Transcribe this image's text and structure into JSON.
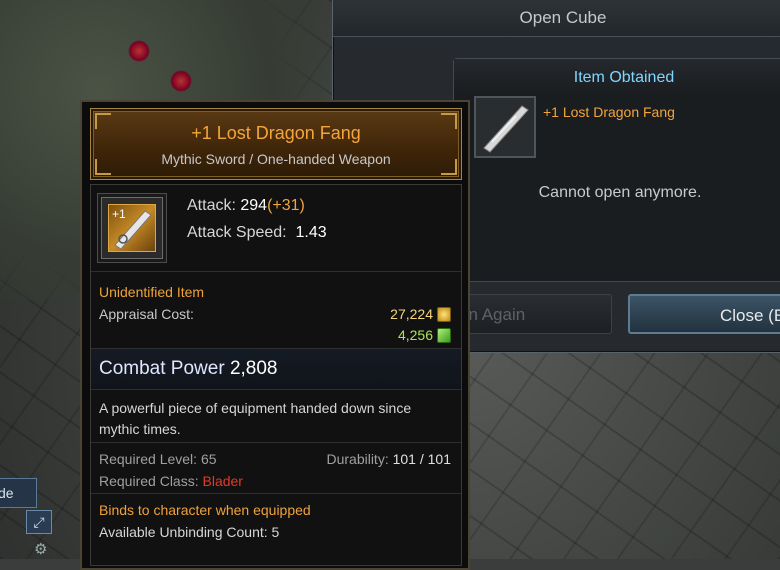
{
  "cube": {
    "title": "Open Cube",
    "panel_header": "Item Obtained",
    "item_name": "+1 Lost Dragon Fang",
    "message": "Cannot open anymore.",
    "open_again_label": "en Again",
    "close_label": "Close (E"
  },
  "side": {
    "tab_label": "de",
    "ctrl_icon": "resize-arrows-icon",
    "gear_icon": "gear-icon"
  },
  "tooltip": {
    "name": "+1 Lost Dragon Fang",
    "type": "Mythic Sword / One-handed Weapon",
    "icon_plus": "+1",
    "attack_label": "Attack:",
    "attack_value": "294",
    "attack_bonus": "(+31)",
    "speed_label": "Attack Speed:",
    "speed_value": "1.43",
    "unidentified": "Unidentified Item",
    "appraisal_label": "Appraisal Cost:",
    "appraisal_zen": "27,224",
    "appraisal_gem": "4,256",
    "power_label": "Combat Power",
    "power_value": "2,808",
    "description": "A powerful piece of equipment handed down since mythic times.",
    "req_level_label": "Required Level:",
    "req_level_value": "65",
    "durability_label": "Durability:",
    "durability_value": "101 / 101",
    "req_class_label": "Required Class:",
    "req_class_value": "Blader",
    "bind_text": "Binds to character when equipped",
    "unbinding_label": "Available Unbinding Count:",
    "unbinding_value": "5"
  },
  "colors": {
    "item_name": "#f4a53a",
    "item_obtained": "#7fd6ff",
    "class_red": "#e03a2a",
    "gem_green": "#a9e35a",
    "zen_gold": "#f4d67a"
  }
}
